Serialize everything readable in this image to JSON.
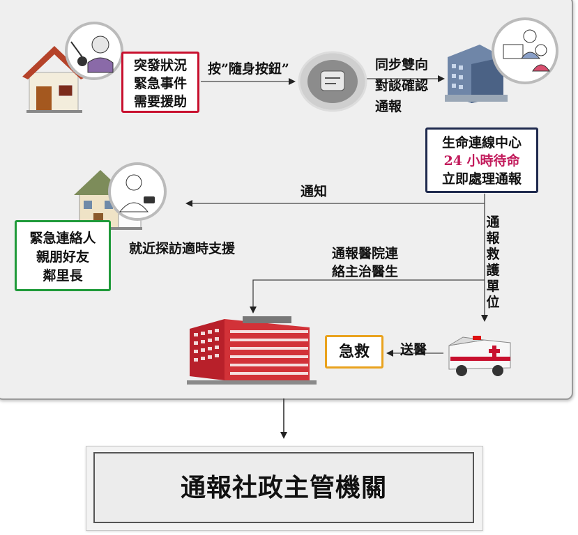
{
  "emergency_box": {
    "lines": [
      "突發狀況",
      "緊急事件",
      "需要援助"
    ]
  },
  "button_label": "按”隨身按鈕”",
  "sync_label": {
    "lines": [
      "同步雙向",
      "對談確認",
      "通報"
    ]
  },
  "center_box": {
    "line1": "生命連線中心",
    "line2": "24 小時待命",
    "line3": "立即處理通報"
  },
  "notify_label": "通知",
  "contacts_box": {
    "lines": [
      "緊急連絡人",
      "親朋好友",
      "鄰里長"
    ]
  },
  "visit_label": "就近探訪適時支援",
  "hospital_label": {
    "lines": [
      "通報醫院連",
      "絡主治醫生"
    ]
  },
  "rescue_label": [
    "通",
    "報",
    "救",
    "護",
    "單",
    "位"
  ],
  "first_aid_box": "急救",
  "send_label": "送醫",
  "final_box": "通報社政主管機關",
  "colors": {
    "emergency": "#c8102e",
    "center": "#1f2a4e",
    "center_accent": "#c21a5b",
    "contacts": "#1f9a3a",
    "first_aid": "#e9a21d"
  }
}
